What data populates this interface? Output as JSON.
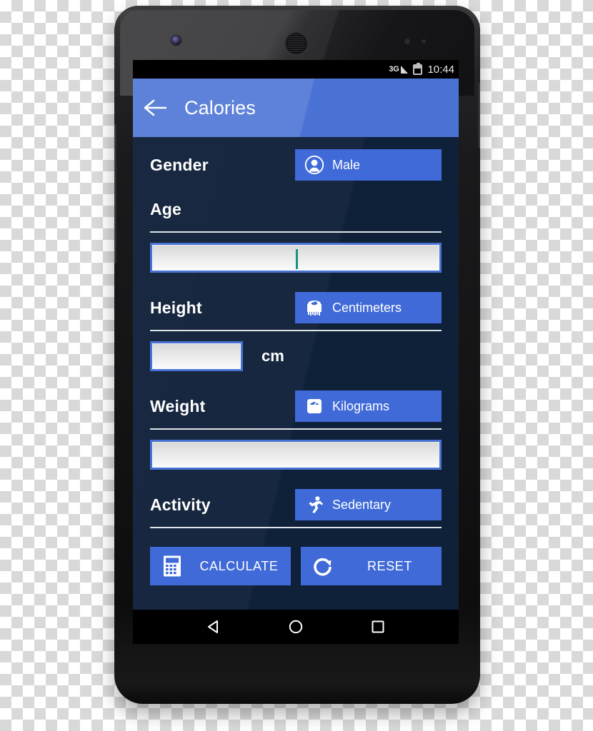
{
  "statusbar": {
    "network": "3G",
    "signal_icon": "signal-triangle-icon",
    "battery_icon": "battery-icon",
    "clock": "10:44"
  },
  "appbar": {
    "back_icon": "back-arrow-icon",
    "title": "Calories",
    "color": "#4a72d4"
  },
  "form": {
    "gender": {
      "label": "Gender",
      "button_label": "Male",
      "button_icon": "user-avatar-icon"
    },
    "age": {
      "label": "Age",
      "value": "",
      "caret_color": "#179481"
    },
    "height": {
      "label": "Height",
      "button_label": "Centimeters",
      "button_icon": "measuring-tape-icon",
      "value": "",
      "unit": "cm"
    },
    "weight": {
      "label": "Weight",
      "button_label": "Kilograms",
      "button_icon": "weight-scale-icon",
      "value": ""
    },
    "activity": {
      "label": "Activity",
      "button_label": "Sedentary",
      "button_icon": "running-person-icon"
    }
  },
  "actions": {
    "calculate": {
      "label": "CALCULATE",
      "icon": "calculator-icon"
    },
    "reset": {
      "label": "RESET",
      "icon": "refresh-circle-icon"
    }
  },
  "navbar": {
    "back": "nav-back-triangle-icon",
    "home": "nav-home-circle-icon",
    "recents": "nav-recents-square-icon"
  },
  "theme": {
    "accent": "#3f6ad8",
    "appbar": "#4a72d4",
    "background": "#0f2039",
    "divider": "#dfe3ea"
  }
}
